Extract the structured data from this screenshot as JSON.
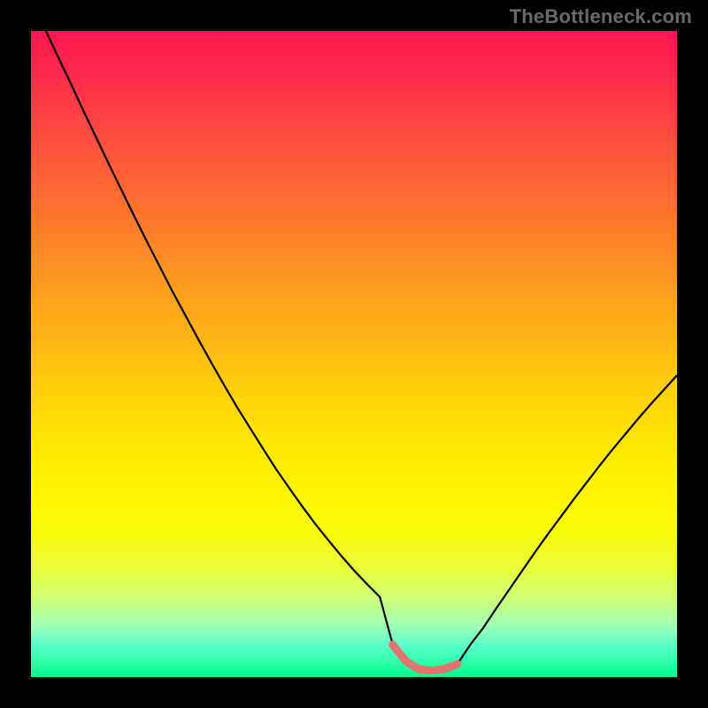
{
  "watermark": {
    "text": "TheBottleneck.com"
  },
  "colors": {
    "background": "#000000",
    "curve_stroke": "#000000",
    "optimal_marker": "#e2756f",
    "gradient_stops": [
      "#ff1451",
      "#ff6633",
      "#ffd10a",
      "#fff700",
      "#05fc8a"
    ]
  },
  "chart_data": {
    "type": "line",
    "title": "",
    "xlabel": "",
    "ylabel": "",
    "xlim": [
      0,
      100
    ],
    "ylim": [
      0,
      100
    ],
    "grid": false,
    "optimal_range_x": [
      55,
      67
    ],
    "series": [
      {
        "name": "bottleneck-curve",
        "x": [
          0,
          2,
          4,
          6,
          8,
          10,
          12,
          14,
          16,
          18,
          20,
          22,
          24,
          26,
          28,
          30,
          32,
          34,
          36,
          38,
          40,
          42,
          44,
          46,
          48,
          50,
          52,
          54,
          56,
          58,
          60,
          62,
          64,
          66,
          68,
          70,
          72,
          74,
          76,
          78,
          80,
          82,
          84,
          86,
          88,
          90,
          92,
          94,
          96,
          98,
          100
        ],
        "values": [
          105.0,
          100.7,
          96.4,
          92.2,
          87.9,
          83.7,
          79.5,
          75.4,
          71.3,
          67.3,
          63.4,
          59.5,
          55.8,
          52.1,
          48.5,
          45.0,
          41.6,
          38.4,
          35.2,
          32.1,
          29.2,
          26.4,
          23.7,
          21.2,
          18.8,
          16.5,
          14.4,
          12.4,
          5.0,
          2.5,
          1.2,
          1.0,
          1.2,
          2.0,
          5.0,
          7.6,
          10.6,
          13.5,
          16.4,
          19.3,
          22.1,
          24.8,
          27.5,
          30.1,
          32.7,
          35.2,
          37.6,
          40.0,
          42.3,
          44.5,
          46.7
        ]
      }
    ]
  }
}
